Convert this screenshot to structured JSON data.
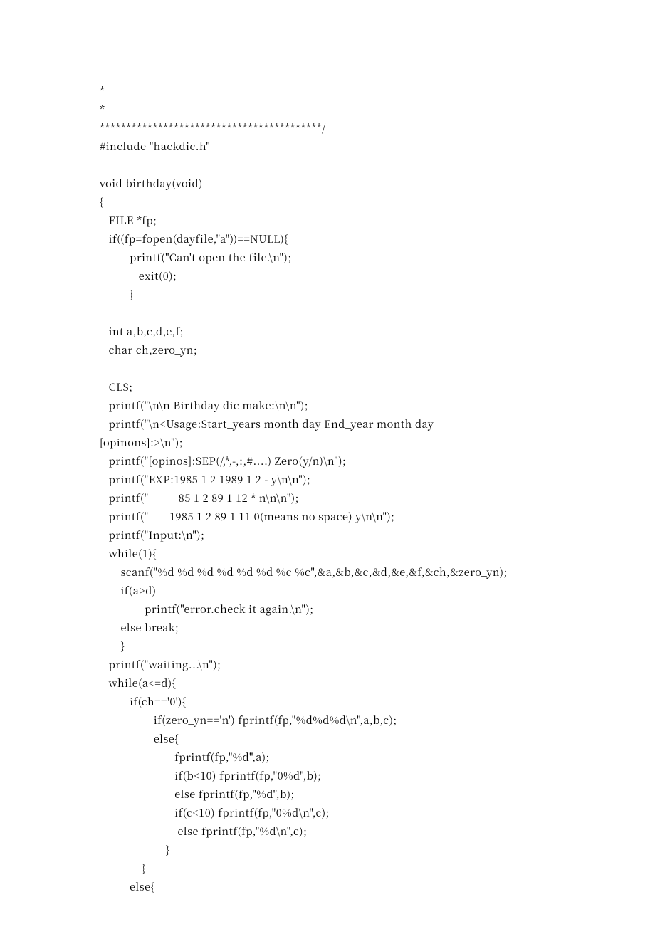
{
  "code_lines": [
    "*",
    "*",
    "******************************************/",
    "#include \"hackdic.h\"",
    "",
    "void birthday(void)",
    "{",
    "   FILE *fp;",
    "   if((fp=fopen(dayfile,\"a\"))==NULL){",
    "          printf(\"Can't open the file.\\n\");",
    "             exit(0);",
    "          }",
    "",
    "   int a,b,c,d,e,f;",
    "   char ch,zero_yn;",
    "",
    "   CLS;",
    "   printf(\"\\n\\n Birthday dic make:\\n\\n\");",
    "   printf(\"\\n<Usage:Start_years month day End_year month day",
    "[opinons]:>\\n\");",
    "   printf(\"[opinos]:SEP(/,*,-,:,#....) Zero(y/n)\\n\");",
    "   printf(\"EXP:1985 1 2 1989 1 2 - y\\n\\n\");",
    "   printf(\"          85 1 2 89 1 12 * n\\n\\n\");",
    "   printf(\"       1985 1 2 89 1 11 0(means no space) y\\n\\n\");",
    "   printf(\"Input:\\n\");",
    "   while(1){",
    "       scanf(\"%d %d %d %d %d %d %c %c\",&a,&b,&c,&d,&e,&f,&ch,&zero_yn);",
    "       if(a>d)",
    "               printf(\"error.check it again.\\n\");",
    "       else break;",
    "       }",
    "   printf(\"waiting...\\n\");",
    "   while(a<=d){",
    "          if(ch=='0'){",
    "                  if(zero_yn=='n') fprintf(fp,\"%d%d%d\\n\",a,b,c);",
    "                  else{",
    "                         fprintf(fp,\"%d\",a);",
    "                         if(b<10) fprintf(fp,\"0%d\",b);",
    "                         else fprintf(fp,\"%d\",b);",
    "                         if(c<10) fprintf(fp,\"0%d\\n\",c);",
    "                          else fprintf(fp,\"%d\\n\",c);",
    "                      }",
    "              }",
    "          else{"
  ]
}
